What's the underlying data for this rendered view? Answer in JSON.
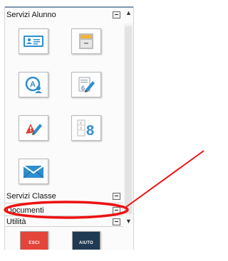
{
  "sections": {
    "alunno": {
      "label": "Servizi Alunno"
    },
    "classe": {
      "label": "Servizi Classe"
    },
    "documenti": {
      "label": "Documenti"
    },
    "utilita": {
      "label": "Utilità"
    }
  },
  "tiles": [
    {
      "icon": "id-card-icon"
    },
    {
      "icon": "file-cabinet-icon"
    },
    {
      "icon": "student-badge-icon"
    },
    {
      "icon": "grade-pen-icon"
    },
    {
      "icon": "note-pen-icon"
    },
    {
      "icon": "calendar-grade-icon"
    },
    {
      "icon": "envelope-icon"
    }
  ],
  "buttons": {
    "esci": {
      "label": "ESCI",
      "color": "#e5443a"
    },
    "aiuto": {
      "label": "AIUTO",
      "color": "#1f3a52"
    }
  },
  "colors": {
    "annotation": "#ee1111",
    "tile_blue": "#2e8ed0",
    "tile_red": "#e43c2f"
  }
}
